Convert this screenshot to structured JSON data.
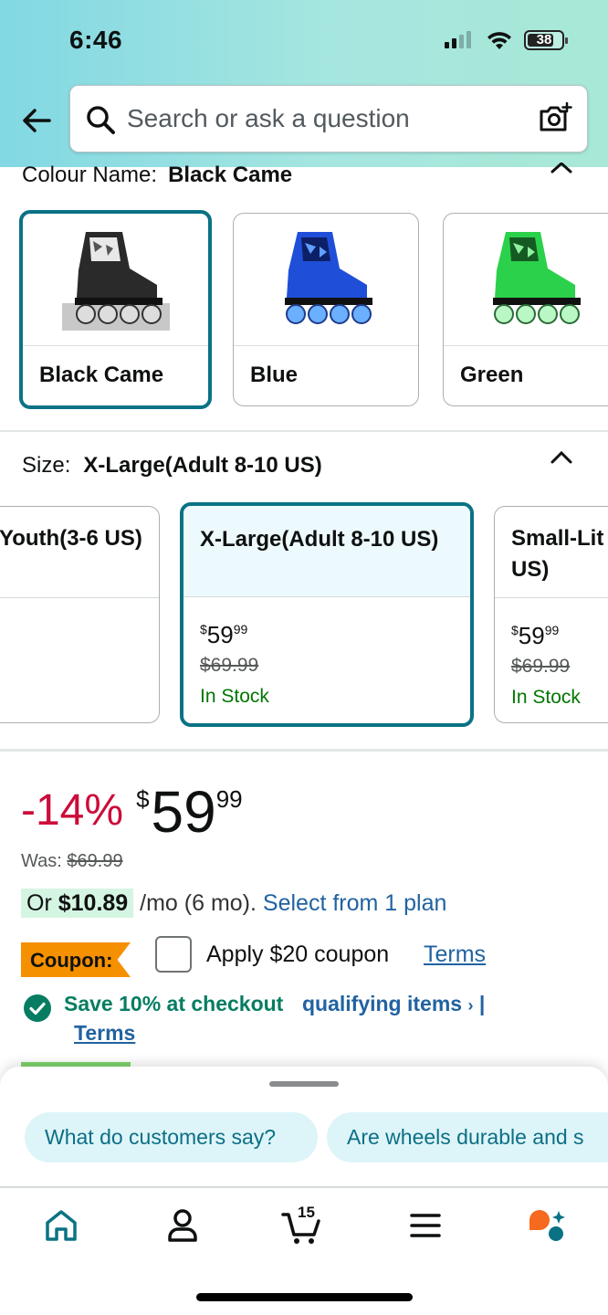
{
  "status_bar": {
    "time": "6:46",
    "battery": "38"
  },
  "search": {
    "placeholder": "Search or ask a question"
  },
  "colour": {
    "label": "Colour Name:",
    "selected": "Black Came",
    "options": [
      {
        "label": "Black Came",
        "color": "#1a1a1a"
      },
      {
        "label": "Blue",
        "color": "#1f4fd8"
      },
      {
        "label": "Green",
        "color": "#2bd14a"
      }
    ]
  },
  "size": {
    "label": "Size:",
    "selected": "X-Large(Adult 8-10 US)",
    "options": [
      {
        "label": "Youth(3-6 US)"
      },
      {
        "label": "X-Large(Adult 8-10 US)",
        "price_whole": "59",
        "price_frac": "99",
        "was": "$69.99",
        "stock": "In Stock"
      },
      {
        "label": "Small-Little Kids(… US)",
        "label_line1": "Small-Lit",
        "label_line2": "US)",
        "price_whole": "59",
        "price_frac": "99",
        "was": "$69.99",
        "stock": "In Stock"
      }
    ],
    "currency": "$"
  },
  "price": {
    "discount": "-14%",
    "currency": "$",
    "whole": "59",
    "fraction": "99",
    "was_label": "Was:",
    "was_value": "$69.99"
  },
  "installment": {
    "or_label": "Or",
    "amount": "$10.89",
    "terms": "/mo (6 mo).",
    "link": "Select from 1 plan"
  },
  "coupon": {
    "tag": "Coupon:",
    "apply_text": "Apply $20 coupon",
    "terms": "Terms"
  },
  "promo": {
    "save_text": "Save 10% at checkout",
    "link": "qualifying items",
    "separator": "|",
    "terms": "Terms"
  },
  "suggestions": [
    "What do customers say?",
    "Are wheels durable and s"
  ],
  "nav": {
    "cart_count": "15"
  },
  "colors": {
    "accent": "#0b7285",
    "deal": "#cc0c39",
    "link": "#2162a1",
    "stock": "#007600",
    "coupon": "#f59000"
  }
}
